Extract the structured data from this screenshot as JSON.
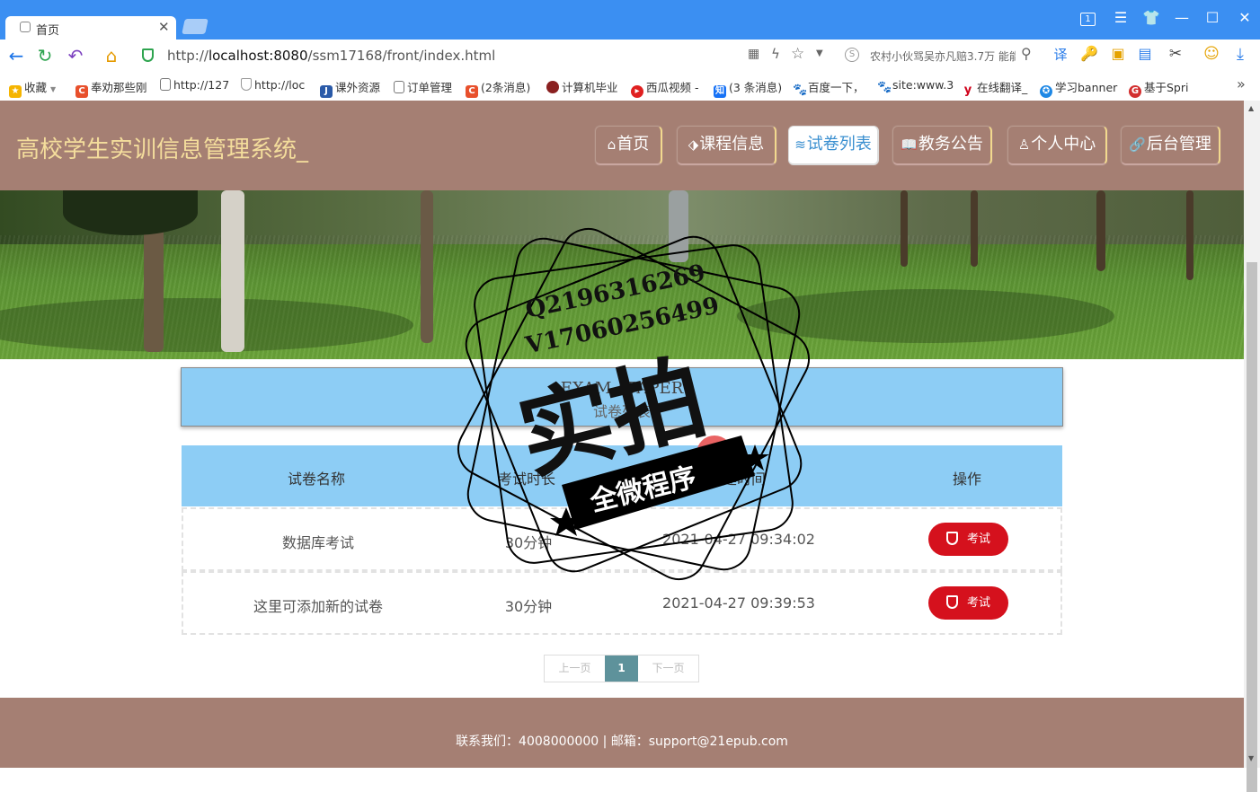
{
  "browser": {
    "tab_title": "首页",
    "url_prefix": "http://",
    "url_host": "localhost:8080",
    "url_path": "/ssm17168/front/index.html",
    "search_text": "农村小伙骂吴亦凡赔3.7万 能能",
    "win_badge": "1",
    "bookmarks": [
      {
        "label": "收藏",
        "icon": "star-icon",
        "color": "#f5b400"
      },
      {
        "label": "奉劝那些刚",
        "icon": "c-logo-icon",
        "color": "#e8502c"
      },
      {
        "label": "http://127",
        "icon": "page-icon",
        "color": "#777777"
      },
      {
        "label": "http://loc",
        "icon": "shield-icon",
        "color": "#999999"
      },
      {
        "label": "课外资源",
        "icon": "course-icon",
        "color": "#2a5aa8"
      },
      {
        "label": "订单管理",
        "icon": "page-icon",
        "color": "#777777"
      },
      {
        "label": "(2条消息)",
        "icon": "c-logo-icon",
        "color": "#e8502c"
      },
      {
        "label": "计算机毕业",
        "icon": "avatar-icon",
        "color": "#8a2020"
      },
      {
        "label": "西瓜视频 -",
        "icon": "play-icon",
        "color": "#e02020"
      },
      {
        "label": "(3 条消息)",
        "icon": "zhihu-icon",
        "color": "#1772f6"
      },
      {
        "label": "百度一下，",
        "icon": "baidu-icon",
        "color": "#2932e1"
      },
      {
        "label": "site:www.3",
        "icon": "baidu-icon",
        "color": "#2932e1"
      },
      {
        "label": "在线翻译_",
        "icon": "y-icon",
        "color": "#d0021b"
      },
      {
        "label": "学习banner",
        "icon": "globe-icon",
        "color": "#1e88e5"
      },
      {
        "label": "基于Spri",
        "icon": "g-icon",
        "color": "#d32f2f"
      }
    ]
  },
  "site": {
    "title": "高校学生实训信息管理系统_",
    "nav": [
      {
        "label": "首页",
        "icon": "⌂",
        "active": false
      },
      {
        "label": "课程信息",
        "icon": "⬗",
        "active": false
      },
      {
        "label": "试卷列表",
        "icon": "≋",
        "active": true
      },
      {
        "label": "教务公告",
        "icon": "📖",
        "active": false
      },
      {
        "label": "个人中心",
        "icon": "♙",
        "active": false
      },
      {
        "label": "后台管理",
        "icon": "🔗",
        "active": false
      }
    ]
  },
  "section": {
    "en": "EXAM / PAPER",
    "cn": "试卷列表"
  },
  "table": {
    "headers": [
      "试卷名称",
      "考试时长",
      "创建时间",
      "操作"
    ],
    "rows": [
      {
        "name": "数据库考试",
        "duration": "30分钟",
        "time": "2021-04-27 09:34:02",
        "action": "考试"
      },
      {
        "name": "这里可添加新的试卷",
        "duration": "30分钟",
        "time": "2021-04-27 09:39:53",
        "action": "考试"
      }
    ]
  },
  "pager": {
    "prev": "上一页",
    "current": "1",
    "next": "下一页"
  },
  "footer": {
    "text": "联系我们：4008000000 | 邮箱：support@21epub.com"
  },
  "watermark": {
    "line1": "Q2196316269",
    "line2": "V17060256499",
    "big": "实拍",
    "ribbon": "全微程序"
  }
}
